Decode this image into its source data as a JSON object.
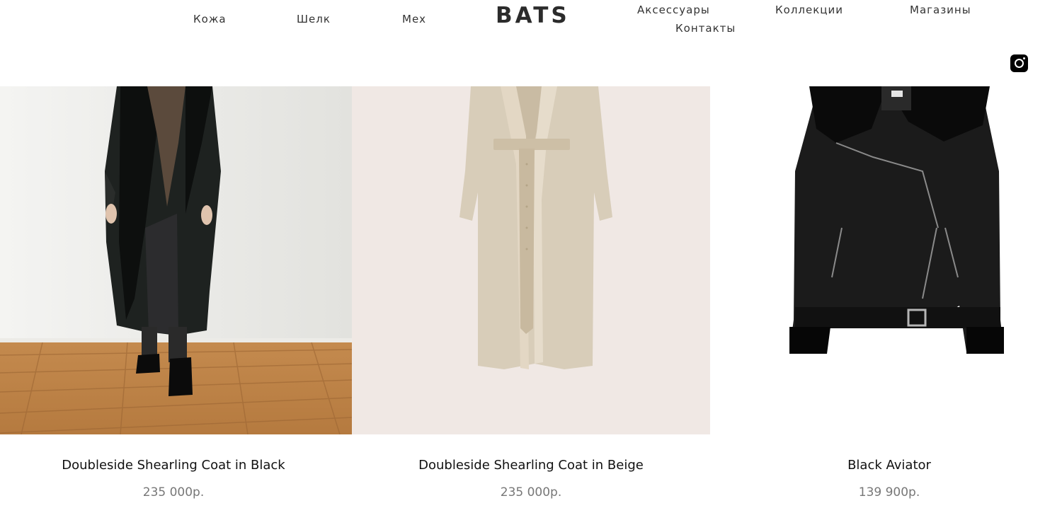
{
  "header": {
    "brand": "BATS",
    "nav_left": [
      "Кожа",
      "Шелк",
      "Мех"
    ],
    "nav_right": [
      "Аксессуары",
      "Коллекции",
      "Магазины"
    ],
    "nav_second_row": "Контакты",
    "social_icon": "instagram-icon"
  },
  "products": [
    {
      "title": "Doubleside Shearling Coat in Black",
      "price": "235 000р."
    },
    {
      "title": "Doubleside Shearling Coat in Beige",
      "price": "235 000р."
    },
    {
      "title": "Black Aviator",
      "price": "139 900р."
    }
  ],
  "colors": {
    "background": "#ffffff",
    "text": "#111111",
    "price": "#777777",
    "beige_backdrop": "#f0e8e4"
  }
}
